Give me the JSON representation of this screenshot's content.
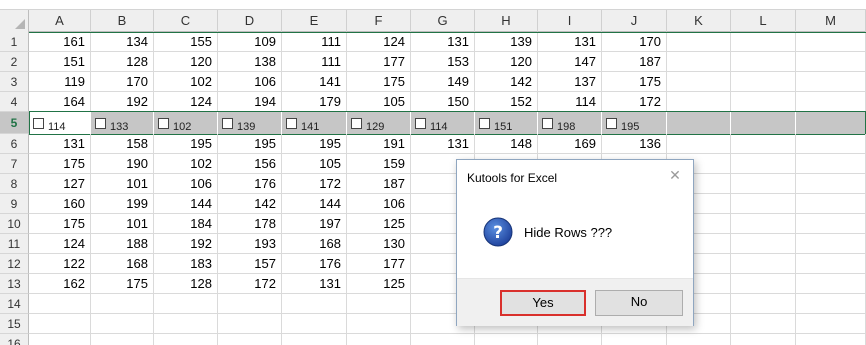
{
  "columns": [
    "A",
    "B",
    "C",
    "D",
    "E",
    "F",
    "G",
    "H",
    "I",
    "J",
    "K",
    "L",
    "M"
  ],
  "rows": [
    {
      "num": "1",
      "values": [
        "161",
        "134",
        "155",
        "109",
        "111",
        "124",
        "131",
        "139",
        "131",
        "170"
      ]
    },
    {
      "num": "2",
      "values": [
        "151",
        "128",
        "120",
        "138",
        "111",
        "177",
        "153",
        "120",
        "147",
        "187"
      ]
    },
    {
      "num": "3",
      "values": [
        "119",
        "170",
        "102",
        "106",
        "141",
        "175",
        "149",
        "142",
        "137",
        "175"
      ]
    },
    {
      "num": "4",
      "values": [
        "164",
        "192",
        "124",
        "194",
        "179",
        "105",
        "150",
        "152",
        "114",
        "172"
      ]
    },
    {
      "num": "5",
      "checkboxes": [
        "114",
        "133",
        "102",
        "139",
        "141",
        "129",
        "114",
        "151",
        "198",
        "195"
      ]
    },
    {
      "num": "6",
      "values": [
        "131",
        "158",
        "195",
        "195",
        "195",
        "191",
        "131",
        "148",
        "169",
        "136"
      ]
    },
    {
      "num": "7",
      "values": [
        "175",
        "190",
        "102",
        "156",
        "105",
        "159",
        "",
        "",
        "",
        ""
      ]
    },
    {
      "num": "8",
      "values": [
        "127",
        "101",
        "106",
        "176",
        "172",
        "187",
        "",
        "",
        "",
        ""
      ]
    },
    {
      "num": "9",
      "values": [
        "160",
        "199",
        "144",
        "142",
        "144",
        "106",
        "",
        "",
        "",
        ""
      ]
    },
    {
      "num": "10",
      "values": [
        "175",
        "101",
        "184",
        "178",
        "197",
        "125",
        "",
        "",
        "",
        ""
      ]
    },
    {
      "num": "11",
      "values": [
        "124",
        "188",
        "192",
        "193",
        "168",
        "130",
        "",
        "",
        "",
        ""
      ]
    },
    {
      "num": "12",
      "values": [
        "122",
        "168",
        "183",
        "157",
        "176",
        "177",
        "",
        "",
        "",
        ""
      ]
    },
    {
      "num": "13",
      "values": [
        "162",
        "175",
        "128",
        "172",
        "131",
        "125",
        "",
        "",
        "",
        ""
      ]
    },
    {
      "num": "14",
      "values": []
    },
    {
      "num": "15",
      "values": []
    },
    {
      "num": "16",
      "values": []
    }
  ],
  "dialog": {
    "title": "Kutools for Excel",
    "close_icon": "close-icon",
    "icon": "question-icon",
    "message": "Hide Rows ???",
    "yes_label": "Yes",
    "no_label": "No"
  },
  "colors": {
    "selection_border": "#217346",
    "highlight_row": "#c6c6c6",
    "yes_outline": "#d9302c"
  }
}
